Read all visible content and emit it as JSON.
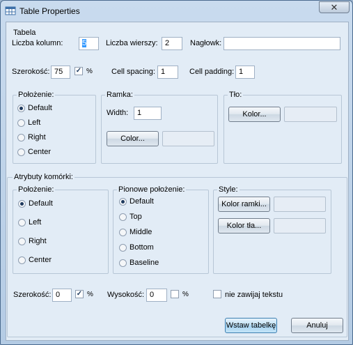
{
  "window": {
    "title": "Table Properties",
    "close_glyph": "✕",
    "app_icon": "table-icon"
  },
  "table": {
    "section_label": "Tabela",
    "columns_label": "Liczba kolumn:",
    "columns_value": "5",
    "rows_label": "Liczba wierszy:",
    "rows_value": "2",
    "header_label": "Nagłowk:",
    "header_value": "",
    "width_label": "Szerokość:",
    "width_value": "75",
    "width_percent_checked": true,
    "percent_symbol": "%",
    "cellspacing_label": "Cell spacing:",
    "cellspacing_value": "1",
    "cellpadding_label": "Cell padding:",
    "cellpadding_value": "1"
  },
  "position_group": {
    "label": "Położenie:",
    "options": [
      "Default",
      "Left",
      "Right",
      "Center"
    ],
    "selected": "Default"
  },
  "frame_group": {
    "label": "Ramka:",
    "width_label": "Width:",
    "width_value": "1",
    "color_button": "Color..."
  },
  "background_group": {
    "label": "Tło:",
    "color_button": "Kolor..."
  },
  "cell_attributes": {
    "label": "Atrybuty komórki:",
    "position": {
      "label": "Położenie:",
      "options": [
        "Default",
        "Left",
        "Right",
        "Center"
      ],
      "selected": "Default"
    },
    "vertical": {
      "label": "Pionowe położenie:",
      "options": [
        "Default",
        "Top",
        "Middle",
        "Bottom",
        "Baseline"
      ],
      "selected": "Default"
    },
    "style": {
      "label": "Style:",
      "border_color_button": "Kolor ramki...",
      "background_color_button": "Kolor tła..."
    },
    "width_label": "Szerokość:",
    "width_value": "0",
    "width_percent_checked": true,
    "height_label": "Wysokość:",
    "height_value": "0",
    "height_percent_checked": false,
    "percent_symbol": "%",
    "nowrap_label": "nie zawijaj tekstu",
    "nowrap_checked": false
  },
  "footer": {
    "insert_button": "Wstaw tabelkę",
    "cancel_button": "Anuluj"
  }
}
